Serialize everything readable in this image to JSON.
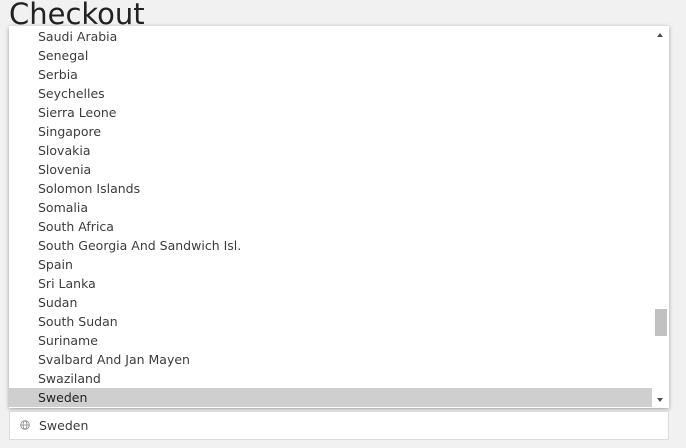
{
  "page": {
    "title": "Checkout"
  },
  "country_dropdown": {
    "options": [
      "Saudi Arabia",
      "Senegal",
      "Serbia",
      "Seychelles",
      "Sierra Leone",
      "Singapore",
      "Slovakia",
      "Slovenia",
      "Solomon Islands",
      "Somalia",
      "South Africa",
      "South Georgia And Sandwich Isl.",
      "Spain",
      "Sri Lanka",
      "Sudan",
      "South Sudan",
      "Suriname",
      "Svalbard And Jan Mayen",
      "Swaziland",
      "Sweden"
    ],
    "selected_index": 19,
    "scroll_position": 0.83
  },
  "country_select": {
    "value": "Sweden",
    "icon": "globe-icon"
  },
  "colors": {
    "selected_option_bg": "#cfcfcf",
    "scroll_thumb": "#c1c1c1"
  }
}
